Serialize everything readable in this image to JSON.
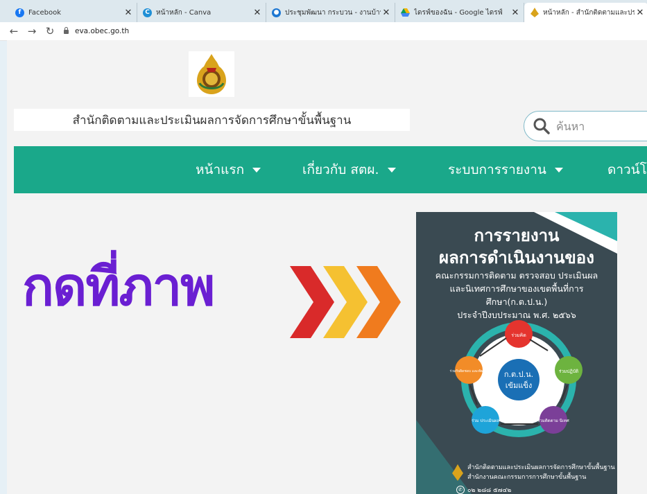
{
  "browser": {
    "tabs": [
      {
        "label": "Facebook",
        "icon": "facebook-icon",
        "color": "#1877f2"
      },
      {
        "label": "หน้าหลัก - Canva",
        "icon": "canva-icon",
        "color": "#1f8fd6"
      },
      {
        "label": "ประชุมพัฒนา กระบวน - งานบ้านสนอ",
        "icon": "chrome-icon",
        "color": "#1e78d2"
      },
      {
        "label": "ไดรฟ์ของฉัน - Google ไดรฟ์",
        "icon": "google-drive-icon",
        "color": "#f4b400"
      },
      {
        "label": "หน้าหลัก - สำนักติดตามและประเมินผล",
        "icon": "obec-logo-icon",
        "color": "#d9a31c"
      }
    ],
    "url": "eva.obec.go.th"
  },
  "site": {
    "name": "สำนักติดตามและประเมินผลการจัดการศึกษาขั้นพื้นฐาน",
    "search_placeholder": "ค้นหา",
    "colors": {
      "nav": "#1aa88a",
      "promo": "#6a1fd2"
    },
    "nav": [
      {
        "label": "หน้าแรก"
      },
      {
        "label": "เกี่ยวกับ สตผ."
      },
      {
        "label": "ระบบการรายงาน"
      },
      {
        "label": "ดาวน์โ"
      }
    ]
  },
  "promo": {
    "text": "กดที่ภาพ"
  },
  "poster": {
    "title_line1": "การรายงาน",
    "title_line2": "ผลการดำเนินงานของ",
    "subtitle_line1": "คณะกรรมการติดตาม ตรวจสอบ ประเมินผล",
    "subtitle_line2": "และนิเทศการศึกษาของเขตพื้นที่การศึกษา(ก.ต.ป.น.)",
    "subtitle_line3": "ประจำปีงบประมาณ พ.ศ. ๒๕๖๖",
    "center_line1": "ก.ต.ป.น.",
    "center_line2": "เข้มแข็ง",
    "nodes": [
      "ร่วมคิด",
      "ร่วมปฏิบัติ",
      "ร่วมติดตาม นิเทศ",
      "ร่วม ประเมินผล",
      "ร่วมรับผิดชอบ และพัฒนา"
    ],
    "footer_line1": "สำนักติดตามและประเมินผลการจัดการศึกษาขั้นพื้นฐาน",
    "footer_line2": "สำนักงานคณะกรรมการการศึกษาขั้นพื้นฐาน",
    "phone": "๐๒ ๒๘๘ ๕๗๔๒"
  }
}
